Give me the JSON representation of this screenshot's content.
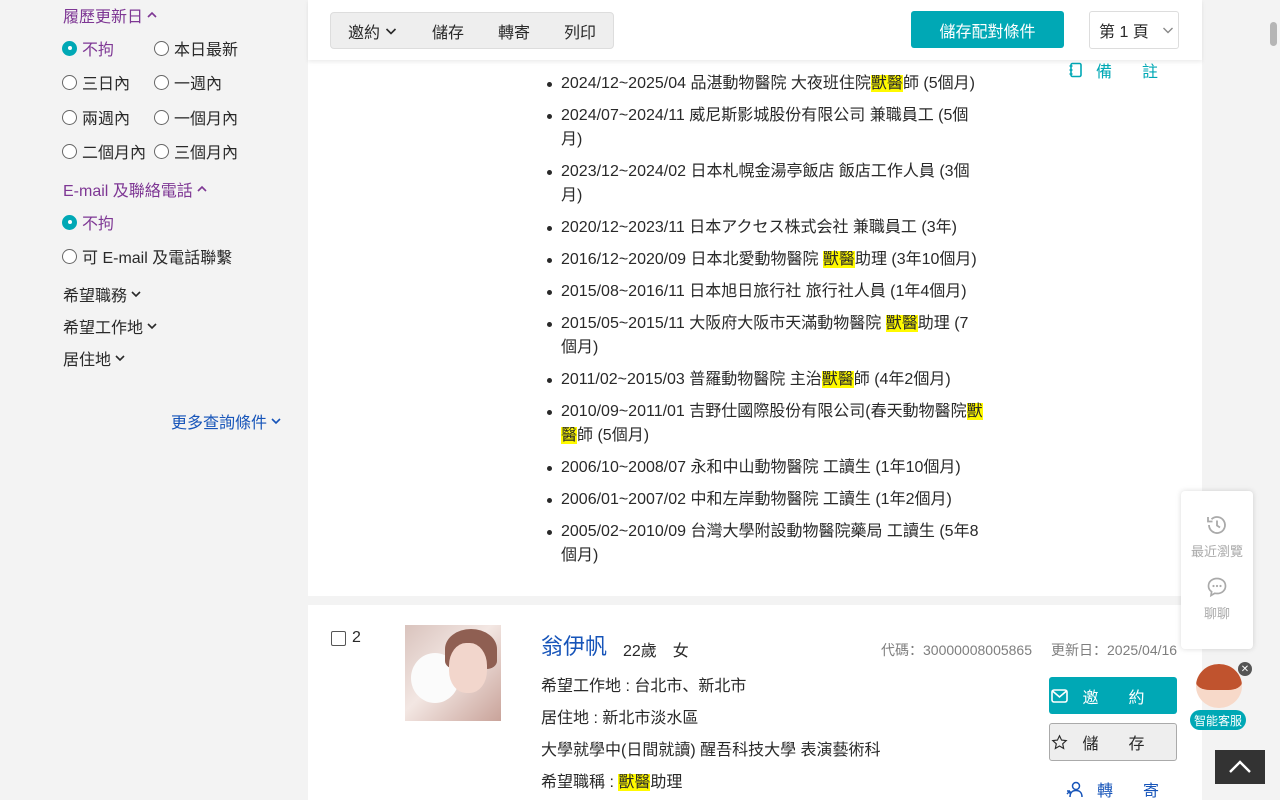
{
  "sidebar": {
    "update_title": "履歷更新日",
    "update_options": [
      "不拘",
      "本日最新",
      "三日內",
      "一週內",
      "兩週內",
      "一個月內",
      "二個月內",
      "三個月內"
    ],
    "contact_title": "E-mail 及聯絡電話",
    "contact_options": [
      "不拘",
      "可 E-mail 及電話聯繫"
    ],
    "desired_job": "希望職務",
    "desired_location": "希望工作地",
    "residence": "居住地",
    "more_conditions": "更多查詢條件"
  },
  "toolbar": {
    "invite": "邀約",
    "save": "儲存",
    "forward": "轉寄",
    "print": "列印",
    "save_match": "儲存配對條件",
    "page": "第 1 頁"
  },
  "card1": {
    "note": "備註",
    "experience": [
      [
        "2024/12~2025/04 品湛動物醫院 大夜班住院",
        "獸醫",
        "師 (5個月)"
      ],
      [
        "2024/07~2024/11 威尼斯影城股份有限公司 兼職員工 (5個月)",
        "",
        ""
      ],
      [
        "2023/12~2024/02 日本札幌金湯亭飯店 飯店工作人員 (3個月)",
        "",
        ""
      ],
      [
        "2020/12~2023/11 日本アクセス株式会社 兼職員工 (3年)",
        "",
        ""
      ],
      [
        "2016/12~2020/09 日本北愛動物醫院 ",
        "獸醫",
        "助理 (3年10個月)"
      ],
      [
        "2015/08~2016/11 日本旭日旅行社 旅行社人員 (1年4個月)",
        "",
        ""
      ],
      [
        "2015/05~2015/11 大阪府大阪市天滿動物醫院 ",
        "獸醫",
        "助理 (7個月)"
      ],
      [
        "2011/02~2015/03 普羅動物醫院 主治",
        "獸醫",
        "師 (4年2個月)"
      ],
      [
        "2010/09~2011/01 吉野仕國際股份有限公司(春天動物醫院",
        "獸醫",
        "師 (5個月)"
      ],
      [
        "2006/10~2008/07 永和中山動物醫院 工讀生 (1年10個月)",
        "",
        ""
      ],
      [
        "2006/01~2007/02 中和左岸動物醫院 工讀生 (1年2個月)",
        "",
        ""
      ],
      [
        "2005/02~2010/09 台灣大學附設動物醫院藥局 工讀生 (5年8個月)",
        "",
        ""
      ]
    ]
  },
  "card2": {
    "index": "2",
    "name": "翁伊帆",
    "age_gender": "22歲　女",
    "code": "代碼：30000008005865",
    "updated": "更新日：2025/04/16",
    "desired_location": "希望工作地 : 台北市、新北市",
    "residence": "居住地 : 新北市淡水區",
    "education": "大學就學中(日間就讀) 醒吾科技大學 表演藝術科",
    "desired_title_prefix": "希望職稱 : ",
    "desired_title_hl": "獸醫",
    "desired_title_suffix": "助理",
    "invite": "邀約",
    "save": "儲存",
    "forward": "轉寄"
  },
  "float": {
    "recent": "最近瀏覽",
    "chat": "聊聊",
    "assistant": "智能客服"
  },
  "colors": {
    "accent": "#00a8b5",
    "purple": "#7e3794",
    "link": "#1654b9",
    "highlight": "#fffa00"
  }
}
